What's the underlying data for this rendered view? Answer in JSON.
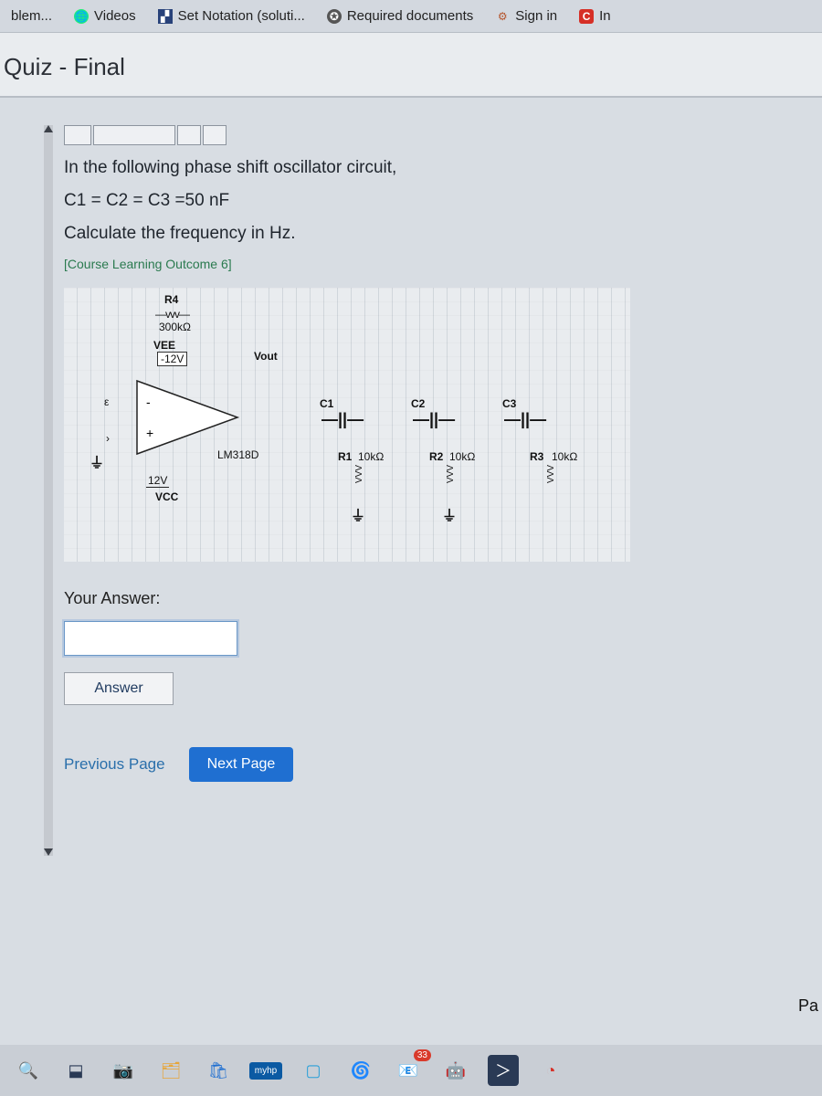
{
  "tabs": {
    "t0": "blem...",
    "t1": "Videos",
    "t2": "Set Notation (soluti...",
    "t3": "Required documents",
    "t4": "Sign in",
    "t5": "In"
  },
  "page": {
    "title": "Quiz - Final"
  },
  "question": {
    "line1": "In the following phase shift oscillator circuit,",
    "line2": "C1 = C2 = C3 =50 nF",
    "line3": "Calculate the frequency in Hz.",
    "clo": "[Course Learning Outcome 6]"
  },
  "circuit": {
    "R4_label": "R4",
    "R4_val": "300kΩ",
    "VEE": "VEE",
    "VEE_v": "-12V",
    "Vout": "Vout",
    "chip": "LM318D",
    "VCC": "VCC",
    "VCC_v": "12V",
    "C1": "C1",
    "C2": "C2",
    "C3": "C3",
    "R1": "R1",
    "R1_v": "10kΩ",
    "R2": "R2",
    "R2_v": "10kΩ",
    "R3": "R3",
    "R3_v": "10kΩ"
  },
  "answer": {
    "label": "Your Answer:",
    "placeholder": "",
    "button": "Answer"
  },
  "pager": {
    "prev": "Previous Page",
    "next": "Next Page",
    "right_cut": "Pa"
  },
  "taskbar": {
    "hp": "myhp",
    "badge": "33"
  }
}
